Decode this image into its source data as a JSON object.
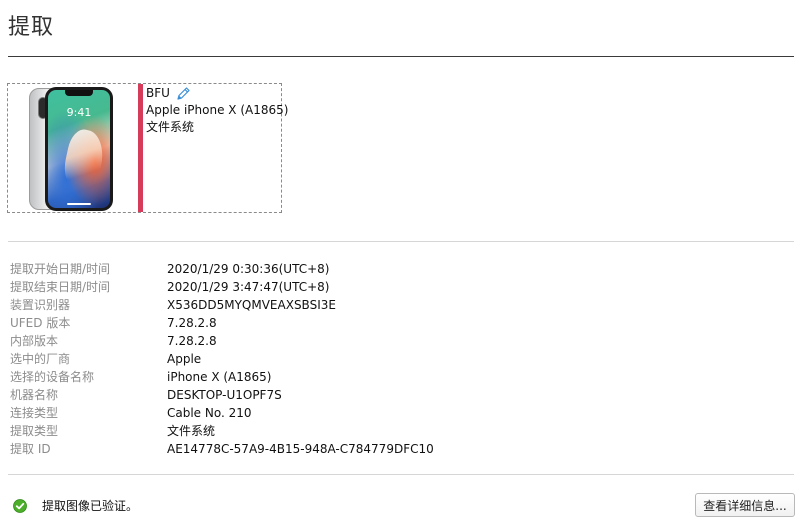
{
  "page": {
    "title": "提取"
  },
  "device_card": {
    "mode": "BFU",
    "model": "Apple iPhone X (A1865)",
    "type": "文件系统",
    "accent_color": "#d63b5a",
    "screen_time": "9:41",
    "edit_icon": "pencil-icon",
    "edit_icon_color": "#3b8fd9"
  },
  "details": {
    "rows": [
      {
        "label": "提取开始日期/时间",
        "value": "2020/1/29 0:30:36(UTC+8)"
      },
      {
        "label": "提取结束日期/时间",
        "value": "2020/1/29 3:47:47(UTC+8)"
      },
      {
        "label": "装置识别器",
        "value": "X536DD5MYQMVEAXSBSI3E"
      },
      {
        "label": "UFED 版本",
        "value": "7.28.2.8"
      },
      {
        "label": "内部版本",
        "value": "7.28.2.8"
      },
      {
        "label": "选中的厂商",
        "value": "Apple"
      },
      {
        "label": "选择的设备名称",
        "value": "iPhone X (A1865)"
      },
      {
        "label": "机器名称",
        "value": "DESKTOP-U1OPF7S"
      },
      {
        "label": "连接类型",
        "value": "Cable No. 210"
      },
      {
        "label": "提取类型",
        "value": "文件系统"
      },
      {
        "label": "提取 ID",
        "value": "AE14778C-57A9-4B15-948A-C784779DFC10"
      }
    ]
  },
  "status": {
    "icon": "check-circle-icon",
    "color": "#4caf2a",
    "text": "提取图像已验证。"
  },
  "actions": {
    "details_button_label": "查看详细信息..."
  }
}
